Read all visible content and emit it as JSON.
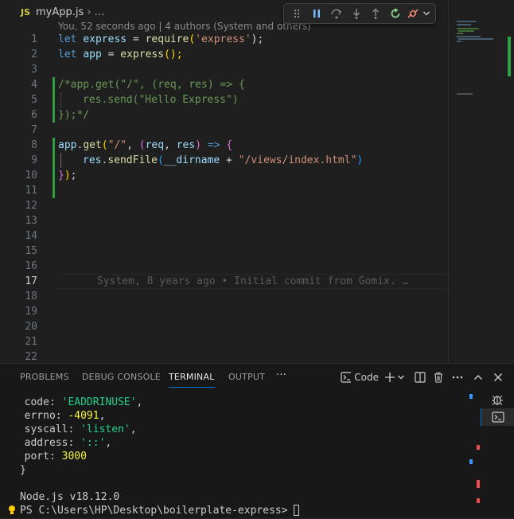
{
  "breadcrumb": {
    "lang_badge": "JS",
    "file": "myApp.js",
    "separator": "›",
    "more": "…"
  },
  "blame_header": "You, 52 seconds ago | 4 authors (System and others)",
  "debug_toolbar": {
    "buttons": [
      "drag-handle",
      "pause",
      "step-over",
      "step-into",
      "step-out",
      "restart",
      "disconnect",
      "more"
    ]
  },
  "editor": {
    "line_numbers": [
      "1",
      "2",
      "3",
      "4",
      "5",
      "6",
      "7",
      "8",
      "9",
      "10",
      "11",
      "12",
      "13",
      "14",
      "15",
      "16",
      "17",
      "18",
      "19",
      "20",
      "21",
      "22"
    ],
    "active_line": "17",
    "lines": {
      "l1": {
        "t1": "let",
        "t2": "express",
        "t3": " = ",
        "t4": "require",
        "t5": "(",
        "t6": "'express'",
        "t7": ");"
      },
      "l2": {
        "t1": "let",
        "t2": "app",
        "t3": " = ",
        "t4": "express",
        "t5": "();"
      },
      "l4": "/*app.get(\"/\", (req, res) => {",
      "l5": "res.send(\"Hello Express\")",
      "l6": "});*/",
      "l8": {
        "t1": "app",
        "t2": ".",
        "t3": "get",
        "t4": "(",
        "t5": "\"/\"",
        "t6": ", ",
        "t7": "(",
        "t8": "req",
        "t9": ", ",
        "t10": "res",
        "t11": ")",
        "t12": " => ",
        "t13": "{"
      },
      "l9": {
        "t1": "res",
        "t2": ".",
        "t3": "sendFile",
        "t4": "(",
        "t5": "__dirname",
        "t6": " + ",
        "t7": "\"/views/index.html\"",
        "t8": ")"
      },
      "l10": {
        "t1": "}",
        "t2": ")",
        "t3": ";"
      }
    },
    "ghost_blame": "System, 8 years ago • Initial commit from Gomix. …"
  },
  "panel": {
    "tabs": [
      "PROBLEMS",
      "DEBUG CONSOLE",
      "TERMINAL",
      "OUTPUT"
    ],
    "active_tab": "TERMINAL",
    "more": "···",
    "terminal_profile": "Code"
  },
  "terminal": {
    "lines": {
      "code_key": "  code: ",
      "code_val": "'EADDRINUSE'",
      "code_end": ",",
      "errno_key": "  errno: ",
      "errno_val": "-4091",
      "errno_end": ",",
      "syscall_key": "  syscall: ",
      "syscall_val": "'listen'",
      "syscall_end": ",",
      "address_key": "  address: ",
      "address_val": "'::'",
      "address_end": ",",
      "port_key": "  port: ",
      "port_val": "3000",
      "close": "}",
      "node_version": "Node.js v18.12.0",
      "prompt": "PS C:\\Users\\HP\\Desktop\\boilerplate-express> "
    }
  },
  "colors": {
    "accent": "#0078d4",
    "git_added": "#2ea043",
    "error_mark": "#f14c4c"
  }
}
